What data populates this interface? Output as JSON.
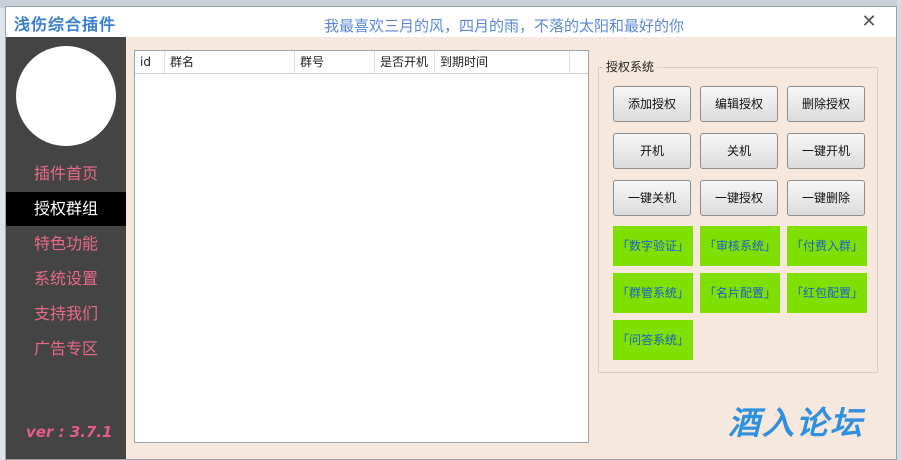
{
  "window": {
    "title": "浅伤综合插件",
    "slogan": "我最喜欢三月的风，四月的雨，不落的太阳和最好的你",
    "close_glyph": "✕"
  },
  "sidebar": {
    "items": [
      {
        "label": "插件首页"
      },
      {
        "label": "授权群组",
        "active": true
      },
      {
        "label": "特色功能"
      },
      {
        "label": "系统设置"
      },
      {
        "label": "支持我们"
      },
      {
        "label": "广告专区"
      }
    ],
    "version": "ver : 3.7.1"
  },
  "table": {
    "columns": [
      "id",
      "群名",
      "群号",
      "是否开机",
      "到期时间",
      ""
    ],
    "rows": []
  },
  "auth_panel": {
    "legend": "授权系统",
    "buttons": [
      "添加授权",
      "编辑授权",
      "删除授权",
      "开机",
      "关机",
      "一键开机",
      "一键关机",
      "一键授权",
      "一键删除"
    ],
    "feature_buttons": [
      "「数字验证」",
      "「审核系统」",
      "「付费入群」",
      "「群管系统」",
      "「名片配置」",
      "「红包配置」",
      "「问答系统」"
    ]
  },
  "watermark": "酒入论坛",
  "colors": {
    "sidebar_bg": "#444444",
    "nav_text": "#e86a87",
    "active_nav_bg": "#000000",
    "window_bg": "#f6e8dc",
    "feature_green": "#7fe000",
    "feature_text": "#1a5fd1",
    "title_blue": "#3a7fd0"
  }
}
